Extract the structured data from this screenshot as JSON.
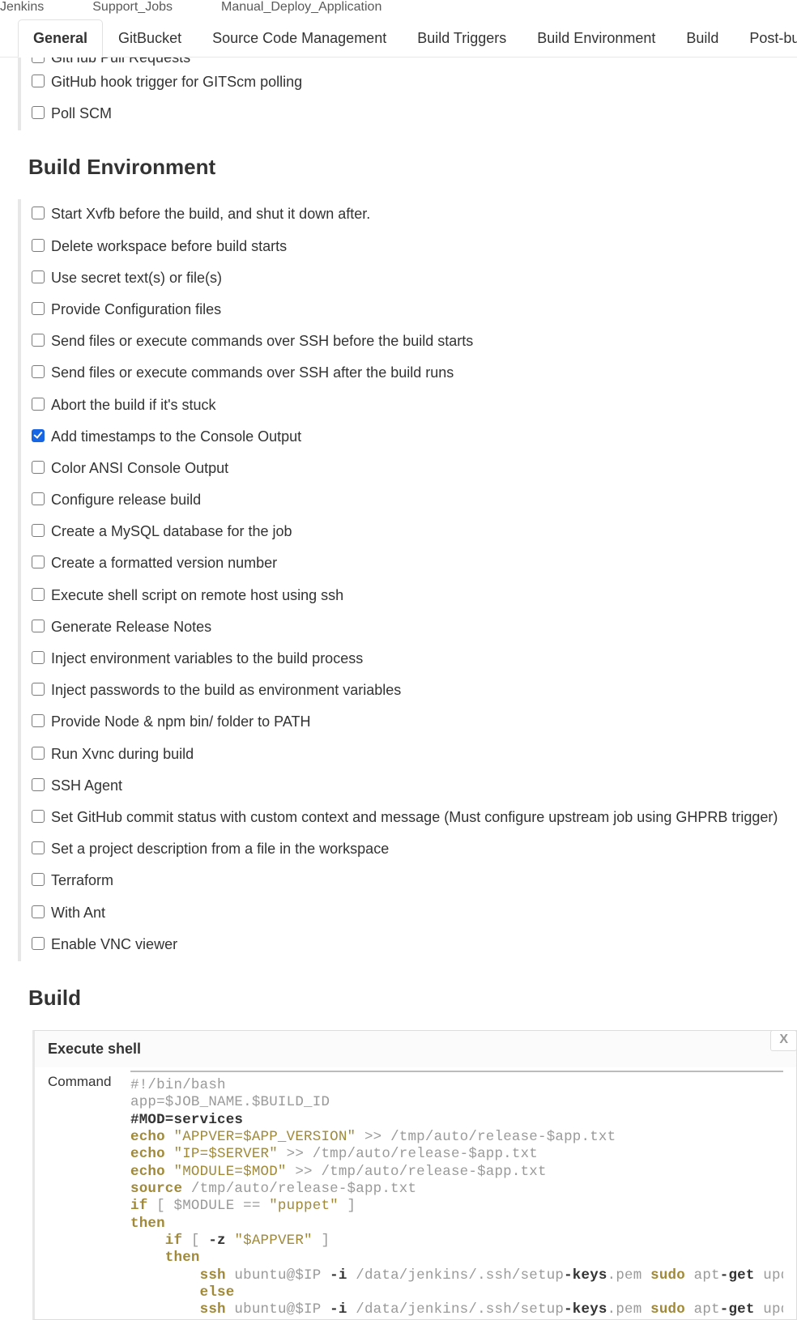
{
  "breadcrumb": {
    "a": "Jenkins",
    "b": "Support_Jobs",
    "c": "Manual_Deploy_Application"
  },
  "tabs": {
    "general": "General",
    "gitbucket": "GitBucket",
    "scm": "Source Code Management",
    "triggers": "Build Triggers",
    "env": "Build Environment",
    "build": "Build",
    "post": "Post-build Actions"
  },
  "triggers": {
    "github_pr": "GitHub Pull Requests",
    "github_hook": "GitHub hook trigger for GITScm polling",
    "poll_scm": "Poll SCM"
  },
  "env_heading": "Build Environment",
  "env": {
    "xvfb": "Start Xvfb before the build, and shut it down after.",
    "delete_ws": "Delete workspace before build starts",
    "secret": "Use secret text(s) or file(s)",
    "cfg_files": "Provide Configuration files",
    "ssh_before": "Send files or execute commands over SSH before the build starts",
    "ssh_after": "Send files or execute commands over SSH after the build runs",
    "abort": "Abort the build if it's stuck",
    "timestamps": "Add timestamps to the Console Output",
    "ansi": "Color ANSI Console Output",
    "release": "Configure release build",
    "mysql": "Create a MySQL database for the job",
    "version": "Create a formatted version number",
    "shell_remote": "Execute shell script on remote host using ssh",
    "rel_notes": "Generate Release Notes",
    "inject_env": "Inject environment variables to the build process",
    "inject_pw": "Inject passwords to the build as environment variables",
    "node_path": "Provide Node & npm bin/ folder to PATH",
    "xvnc": "Run Xvnc during build",
    "ssh_agent": "SSH Agent",
    "gh_commit": "Set GitHub commit status with custom context and message (Must configure upstream job using GHPRB trigger)",
    "proj_desc": "Set a project description from a file in the workspace",
    "terraform": "Terraform",
    "ant": "With Ant",
    "vnc_viewer": "Enable VNC viewer"
  },
  "build_heading": "Build",
  "step": {
    "title": "Execute shell",
    "close": "X",
    "cmd_label": "Command"
  },
  "code": {
    "l1": "#!/bin/bash",
    "l2": "app=$JOB_NAME.$BUILD_ID",
    "l3": "#MOD=services",
    "l4a": "echo",
    "l4b": " \"APPVER=$APP_VERSION\"",
    "l4c": " >> /tmp/auto/release-$app.txt",
    "l5a": "echo",
    "l5b": " \"IP=$SERVER\"",
    "l5c": " >> /tmp/auto/release-$app.txt",
    "l6a": "echo",
    "l6b": " \"MODULE=$MOD\"",
    "l6c": " >> /tmp/auto/release-$app.txt",
    "l7a": "source",
    "l7b": " /tmp/auto/release-$app.txt",
    "l8a": "if",
    "l8b": " [ $MODULE == ",
    "l8c": "\"puppet\"",
    "l8d": " ]",
    "l9": "then",
    "l10a": "    if",
    "l10b": " [ ",
    "l10c": "-z",
    "l10d": " ",
    "l10e": "\"$APPVER\"",
    "l10f": " ]",
    "l11": "    then",
    "l12a": "        ssh",
    "l12b": " ubuntu@$IP ",
    "l12c": "-i",
    "l12d": " /data/jenkins/.ssh/setup",
    "l12e": "-keys",
    "l12f": ".pem ",
    "l12g": "sudo",
    "l12h": " apt",
    "l12i": "-get",
    "l12j": " update",
    "l13": "        else",
    "l14a": "        ssh",
    "l14b": " ubuntu@$IP ",
    "l14c": "-i",
    "l14d": " /data/jenkins/.ssh/setup",
    "l14e": "-keys",
    "l14f": ".pem ",
    "l14g": "sudo",
    "l14h": " apt",
    "l14i": "-get",
    "l14j": " update"
  }
}
